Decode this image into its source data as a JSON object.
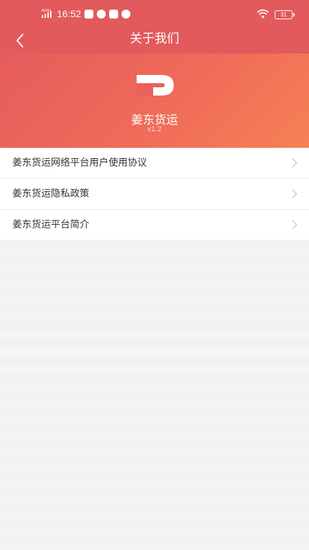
{
  "status_bar": {
    "network": "4GHD",
    "time": "16:52",
    "battery": "31",
    "icons": [
      "signal-icon",
      "mail-icon",
      "compass-icon",
      "security-icon",
      "chat-icon",
      "wifi-icon",
      "battery-icon"
    ]
  },
  "nav": {
    "title": "关于我们",
    "back_icon": "back-chevron-icon"
  },
  "hero": {
    "app_name": "姜东货运",
    "version": "v1.2",
    "logo_icon": "app-logo"
  },
  "menu": {
    "items": [
      {
        "label": "姜东货运网络平台用户使用协议",
        "icon": "chevron-right-icon"
      },
      {
        "label": "姜东货运隐私政策",
        "icon": "chevron-right-icon"
      },
      {
        "label": "姜东货运平台简介",
        "icon": "chevron-right-icon"
      }
    ]
  },
  "colors": {
    "primary": "#e25a5c",
    "gradient_end": "#f57f53",
    "background": "#f2f2f2",
    "text": "#333333",
    "chevron": "#c8c8c8"
  }
}
